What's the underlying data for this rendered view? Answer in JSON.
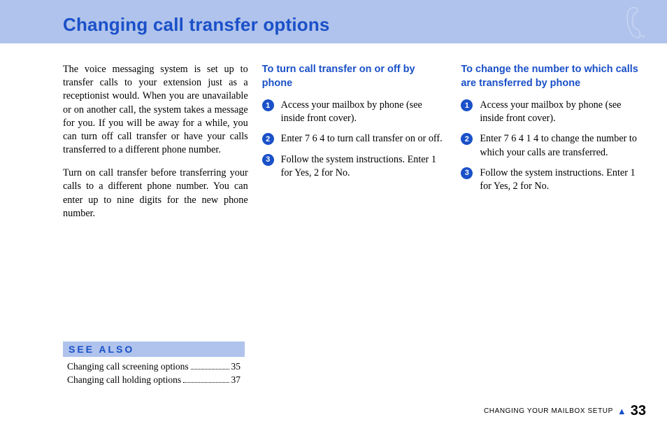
{
  "page": {
    "title": "Changing call transfer options"
  },
  "intro": {
    "p1": "The voice messaging system is set up to transfer calls to your extension just as a receptionist would. When you are unavailable or on another call, the sys­tem takes a message for you. If you will be away for a while, you can turn off call transfer or have your calls transferred to a different phone number.",
    "p2": "Turn on call transfer before transferring your calls to a different phone number. You can enter up to nine digits for the new phone number."
  },
  "col2": {
    "heading": "To turn call transfer on or off by phone",
    "steps": {
      "s1": "Access your mailbox by phone (see inside front cover).",
      "s2": "Enter 7 6 4 to turn call transfer on or off.",
      "s3": "Follow the system instructions. Enter 1 for Yes, 2 for No."
    }
  },
  "col3": {
    "heading": "To change the number to which calls are transferred by phone",
    "steps": {
      "s1": "Access your mailbox by phone (see inside front cover).",
      "s2": "Enter 7 6 4 1 4 to change the number to which your calls are transferred.",
      "s3": "Follow the system instructions. Enter 1 for Yes, 2 for No."
    }
  },
  "badges": {
    "b1": "1",
    "b2": "2",
    "b3": "3"
  },
  "see_also": {
    "title": "SEE ALSO",
    "items": {
      "i1": {
        "label": "Changing call screening options",
        "page": "35"
      },
      "i2": {
        "label": "Changing call holding options",
        "page": "37"
      }
    }
  },
  "footer": {
    "section": "CHANGING YOUR MAILBOX SETUP",
    "page": "33"
  }
}
